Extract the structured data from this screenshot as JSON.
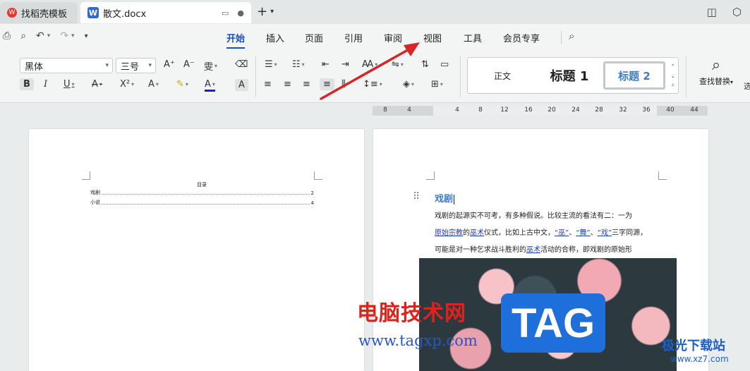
{
  "tabs": [
    {
      "label": "找稻壳模板",
      "icon": "wps-logo-icon"
    },
    {
      "label": "散文.docx",
      "icon": "word-doc-icon"
    }
  ],
  "menu": {
    "items": [
      "开始",
      "插入",
      "页面",
      "引用",
      "审阅",
      "视图",
      "工具",
      "会员专享"
    ],
    "active": "开始"
  },
  "ribbon": {
    "font_name": "黑体",
    "font_size": "三号",
    "styles": {
      "normal": "正文",
      "heading1": "标题 1",
      "heading2": "标题 2"
    },
    "find_replace": "查找替换",
    "truncated": "选"
  },
  "ruler_ticks": [
    "8",
    "4",
    "4",
    "8",
    "12",
    "16",
    "20",
    "24",
    "28",
    "32",
    "36",
    "40",
    "44"
  ],
  "left_page": {
    "toc_title": "目录",
    "toc": [
      {
        "text": "戏剧",
        "page": "2"
      },
      {
        "text": "小说",
        "page": "4"
      }
    ]
  },
  "right_page": {
    "heading": "戏剧",
    "line1": "戏剧的起源实不可考，有多种假说。比较主流的看法有二：一为",
    "line2": {
      "l1": "原始宗教",
      "t1": "的",
      "l2": "巫术",
      "t2": "仪式，比如上古中文，",
      "q1": "“巫”",
      "t3": "、",
      "q2": "“舞”",
      "t4": "、",
      "q3": "“戏”",
      "t5": "三字同源，"
    },
    "line3": {
      "t1": "可能是对一种乞求战斗胜利的",
      "l1": "巫术",
      "t2": "活动的合称，即戏剧的原始形"
    }
  },
  "watermarks": {
    "cn": "电脑技术网",
    "url": "www.tagxp.com",
    "tag": "TAG",
    "jg": "极光下载站",
    "jg_url": "www.xz7.com"
  },
  "colors": {
    "accent": "#1c4fbb",
    "heading_blue": "#3e7cc7",
    "arrow_red": "#d3272a"
  }
}
